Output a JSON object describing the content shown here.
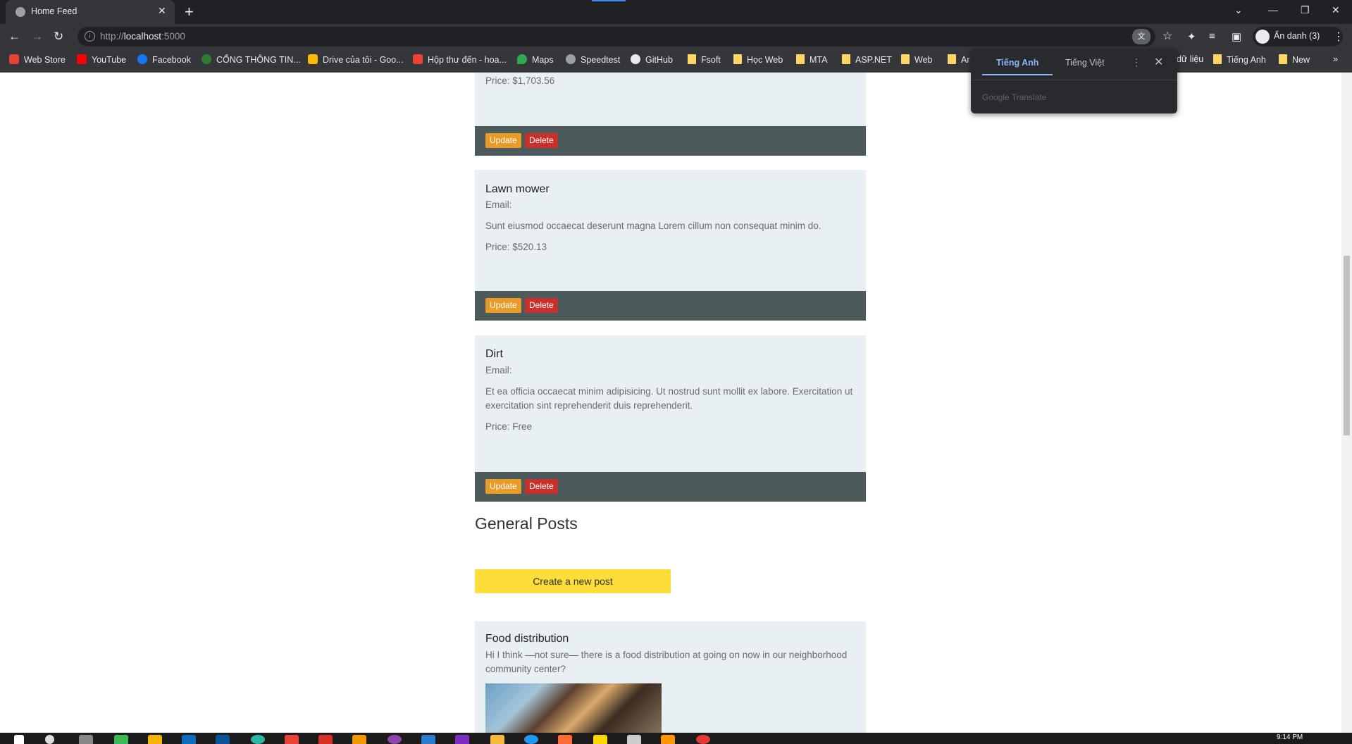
{
  "browser": {
    "tab_title": "Home Feed",
    "url_prefix": "http://",
    "url_host": "localhost",
    "url_port": ":5000",
    "profile_label": "Ẩn danh (3)",
    "bookmarks": [
      "Web Store",
      "YouTube",
      "Facebook",
      "CỔNG THÔNG TIN...",
      "Drive của tôi - Goo...",
      "Hộp thư đến - hoa...",
      "Maps",
      "Speedtest",
      "GitHub",
      "Fsoft",
      "Học Web",
      "MTA",
      "ASP.NET",
      "Web",
      "Ar",
      "dữ liệu",
      "Tiếng Anh",
      "New"
    ]
  },
  "translate": {
    "source_lang": "Tiếng Anh",
    "target_lang": "Tiếng Việt",
    "brand": "Google Translate"
  },
  "partial_card": {
    "price": "Price: $1,703.56"
  },
  "cards": [
    {
      "name": "Lawn mower",
      "email": "Email:",
      "description": "Sunt eiusmod occaecat deserunt magna Lorem cillum non consequat minim do.",
      "price": "Price: $520.13"
    },
    {
      "name": "Dirt",
      "email": "Email:",
      "description": "Et ea officia occaecat minim adipisicing. Ut nostrud sunt mollit ex labore. Exercitation ut exercitation sint reprehenderit duis reprehenderit.",
      "price": "Price: Free"
    }
  ],
  "buttons": {
    "update": "Update",
    "delete": "Delete"
  },
  "general": {
    "heading": "General Posts",
    "create_label": "Create a new post"
  },
  "posts": [
    {
      "title": "Food distribution",
      "body": "Hi I think —not sure— there is a food distribution at going on now in our neighborhood community center?"
    }
  ],
  "clock": "9:14 PM"
}
